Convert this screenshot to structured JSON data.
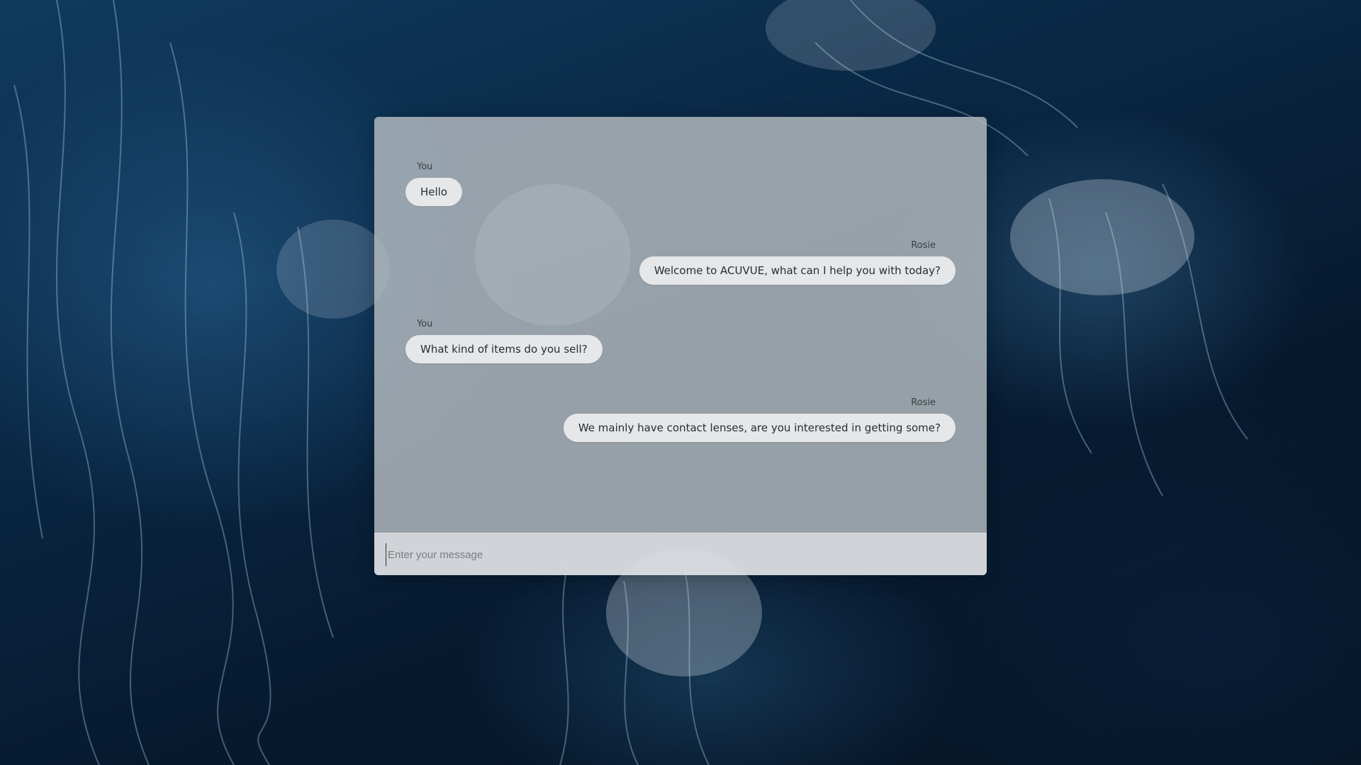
{
  "chat": {
    "messages": [
      {
        "sender": "You",
        "text": "Hello",
        "side": "left"
      },
      {
        "sender": "Rosie",
        "text": "Welcome to ACUVUE, what can I help you with today?",
        "side": "right"
      },
      {
        "sender": "You",
        "text": "What kind of items do you sell?",
        "side": "left"
      },
      {
        "sender": "Rosie",
        "text": "We mainly have contact lenses, are you interested in getting some?",
        "side": "right"
      }
    ]
  },
  "input": {
    "placeholder": "Enter your message",
    "value": ""
  },
  "colors": {
    "panel": "#c8ccd0",
    "bubble": "#ecedee",
    "background": "#061a2e"
  }
}
